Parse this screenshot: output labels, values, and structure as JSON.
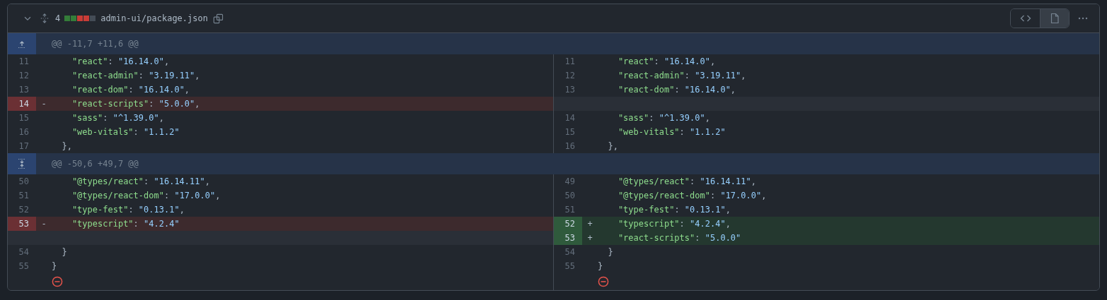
{
  "file_header": {
    "expanded": true,
    "changes": "4",
    "diffstat": [
      {
        "color": "#347d39"
      },
      {
        "color": "#347d39"
      },
      {
        "color": "#c93c37"
      },
      {
        "color": "#c93c37"
      },
      {
        "color": "#444c56"
      }
    ],
    "path": "admin-ui/package.json",
    "views": [
      {
        "kind": "code",
        "selected": false
      },
      {
        "kind": "file",
        "selected": true
      }
    ]
  },
  "rows": [
    {
      "kind": "hunk",
      "expander": {
        "kind": "up"
      },
      "text": "@@ -11,7 +11,6 @@"
    },
    {
      "kind": "line",
      "left": {
        "kind": "context",
        "num": "11",
        "code": [
          {
            "kind": "key",
            "s": "    \"react\""
          },
          {
            "kind": "punct",
            "s": ": "
          },
          {
            "kind": "value",
            "s": "\"16.14.0\""
          },
          {
            "kind": "punct",
            "s": ","
          }
        ]
      },
      "right": {
        "kind": "context",
        "num": "11",
        "code": [
          {
            "kind": "key",
            "s": "    \"react\""
          },
          {
            "kind": "punct",
            "s": ": "
          },
          {
            "kind": "value",
            "s": "\"16.14.0\""
          },
          {
            "kind": "punct",
            "s": ","
          }
        ]
      }
    },
    {
      "kind": "line",
      "left": {
        "kind": "context",
        "num": "12",
        "code": [
          {
            "kind": "key",
            "s": "    \"react-admin\""
          },
          {
            "kind": "punct",
            "s": ": "
          },
          {
            "kind": "value",
            "s": "\"3.19.11\""
          },
          {
            "kind": "punct",
            "s": ","
          }
        ]
      },
      "right": {
        "kind": "context",
        "num": "12",
        "code": [
          {
            "kind": "key",
            "s": "    \"react-admin\""
          },
          {
            "kind": "punct",
            "s": ": "
          },
          {
            "kind": "value",
            "s": "\"3.19.11\""
          },
          {
            "kind": "punct",
            "s": ","
          }
        ]
      }
    },
    {
      "kind": "line",
      "left": {
        "kind": "context",
        "num": "13",
        "code": [
          {
            "kind": "key",
            "s": "    \"react-dom\""
          },
          {
            "kind": "punct",
            "s": ": "
          },
          {
            "kind": "value",
            "s": "\"16.14.0\""
          },
          {
            "kind": "punct",
            "s": ","
          }
        ]
      },
      "right": {
        "kind": "context",
        "num": "13",
        "code": [
          {
            "kind": "key",
            "s": "    \"react-dom\""
          },
          {
            "kind": "punct",
            "s": ": "
          },
          {
            "kind": "value",
            "s": "\"16.14.0\""
          },
          {
            "kind": "punct",
            "s": ","
          }
        ]
      }
    },
    {
      "kind": "line",
      "left": {
        "kind": "deletion",
        "num": "14",
        "sign": "-",
        "code": [
          {
            "kind": "key",
            "s": "    \"react-scripts\""
          },
          {
            "kind": "punct",
            "s": ": "
          },
          {
            "kind": "value",
            "s": "\"5.0.0\""
          },
          {
            "kind": "punct",
            "s": ","
          }
        ]
      },
      "right": {
        "kind": "empty"
      }
    },
    {
      "kind": "line",
      "left": {
        "kind": "context",
        "num": "15",
        "code": [
          {
            "kind": "key",
            "s": "    \"sass\""
          },
          {
            "kind": "punct",
            "s": ": "
          },
          {
            "kind": "value",
            "s": "\"^1.39.0\""
          },
          {
            "kind": "punct",
            "s": ","
          }
        ]
      },
      "right": {
        "kind": "context",
        "num": "14",
        "code": [
          {
            "kind": "key",
            "s": "    \"sass\""
          },
          {
            "kind": "punct",
            "s": ": "
          },
          {
            "kind": "value",
            "s": "\"^1.39.0\""
          },
          {
            "kind": "punct",
            "s": ","
          }
        ]
      }
    },
    {
      "kind": "line",
      "left": {
        "kind": "context",
        "num": "16",
        "code": [
          {
            "kind": "key",
            "s": "    \"web-vitals\""
          },
          {
            "kind": "punct",
            "s": ": "
          },
          {
            "kind": "value",
            "s": "\"1.1.2\""
          }
        ]
      },
      "right": {
        "kind": "context",
        "num": "15",
        "code": [
          {
            "kind": "key",
            "s": "    \"web-vitals\""
          },
          {
            "kind": "punct",
            "s": ": "
          },
          {
            "kind": "value",
            "s": "\"1.1.2\""
          }
        ]
      }
    },
    {
      "kind": "line",
      "left": {
        "kind": "context",
        "num": "17",
        "code": [
          {
            "kind": "punct",
            "s": "  },"
          }
        ]
      },
      "right": {
        "kind": "context",
        "num": "16",
        "code": [
          {
            "kind": "punct",
            "s": "  },"
          }
        ]
      }
    },
    {
      "kind": "hunk",
      "expander": {
        "kind": "both"
      },
      "text": "@@ -50,6 +49,7 @@"
    },
    {
      "kind": "line",
      "left": {
        "kind": "context",
        "num": "50",
        "code": [
          {
            "kind": "key",
            "s": "    \"@types/react\""
          },
          {
            "kind": "punct",
            "s": ": "
          },
          {
            "kind": "value",
            "s": "\"16.14.11\""
          },
          {
            "kind": "punct",
            "s": ","
          }
        ]
      },
      "right": {
        "kind": "context",
        "num": "49",
        "code": [
          {
            "kind": "key",
            "s": "    \"@types/react\""
          },
          {
            "kind": "punct",
            "s": ": "
          },
          {
            "kind": "value",
            "s": "\"16.14.11\""
          },
          {
            "kind": "punct",
            "s": ","
          }
        ]
      }
    },
    {
      "kind": "line",
      "left": {
        "kind": "context",
        "num": "51",
        "code": [
          {
            "kind": "key",
            "s": "    \"@types/react-dom\""
          },
          {
            "kind": "punct",
            "s": ": "
          },
          {
            "kind": "value",
            "s": "\"17.0.0\""
          },
          {
            "kind": "punct",
            "s": ","
          }
        ]
      },
      "right": {
        "kind": "context",
        "num": "50",
        "code": [
          {
            "kind": "key",
            "s": "    \"@types/react-dom\""
          },
          {
            "kind": "punct",
            "s": ": "
          },
          {
            "kind": "value",
            "s": "\"17.0.0\""
          },
          {
            "kind": "punct",
            "s": ","
          }
        ]
      }
    },
    {
      "kind": "line",
      "left": {
        "kind": "context",
        "num": "52",
        "code": [
          {
            "kind": "key",
            "s": "    \"type-fest\""
          },
          {
            "kind": "punct",
            "s": ": "
          },
          {
            "kind": "value",
            "s": "\"0.13.1\""
          },
          {
            "kind": "punct",
            "s": ","
          }
        ]
      },
      "right": {
        "kind": "context",
        "num": "51",
        "code": [
          {
            "kind": "key",
            "s": "    \"type-fest\""
          },
          {
            "kind": "punct",
            "s": ": "
          },
          {
            "kind": "value",
            "s": "\"0.13.1\""
          },
          {
            "kind": "punct",
            "s": ","
          }
        ]
      }
    },
    {
      "kind": "line",
      "left": {
        "kind": "deletion",
        "num": "53",
        "sign": "-",
        "code": [
          {
            "kind": "key",
            "s": "    \"typescript\""
          },
          {
            "kind": "punct",
            "s": ": "
          },
          {
            "kind": "value",
            "s": "\"4.2.4\""
          }
        ]
      },
      "right": {
        "kind": "addition",
        "num": "52",
        "sign": "+",
        "code": [
          {
            "kind": "key",
            "s": "    \"typescript\""
          },
          {
            "kind": "punct",
            "s": ": "
          },
          {
            "kind": "value",
            "s": "\"4.2.4\""
          },
          {
            "kind": "punct",
            "s": ","
          }
        ]
      }
    },
    {
      "kind": "line",
      "left": {
        "kind": "empty"
      },
      "right": {
        "kind": "addition",
        "num": "53",
        "sign": "+",
        "code": [
          {
            "kind": "key",
            "s": "    \"react-scripts\""
          },
          {
            "kind": "punct",
            "s": ": "
          },
          {
            "kind": "value",
            "s": "\"5.0.0\""
          }
        ]
      }
    },
    {
      "kind": "line",
      "left": {
        "kind": "context",
        "num": "54",
        "code": [
          {
            "kind": "punct",
            "s": "  }"
          }
        ]
      },
      "right": {
        "kind": "context",
        "num": "54",
        "code": [
          {
            "kind": "punct",
            "s": "  }"
          }
        ]
      }
    },
    {
      "kind": "line",
      "left": {
        "kind": "context",
        "num": "55",
        "code": [
          {
            "kind": "punct",
            "s": "}"
          }
        ]
      },
      "right": {
        "kind": "context",
        "num": "55",
        "code": [
          {
            "kind": "punct",
            "s": "}"
          }
        ]
      }
    },
    {
      "kind": "line",
      "left": {
        "kind": "no-newline"
      },
      "right": {
        "kind": "no-newline"
      }
    }
  ]
}
